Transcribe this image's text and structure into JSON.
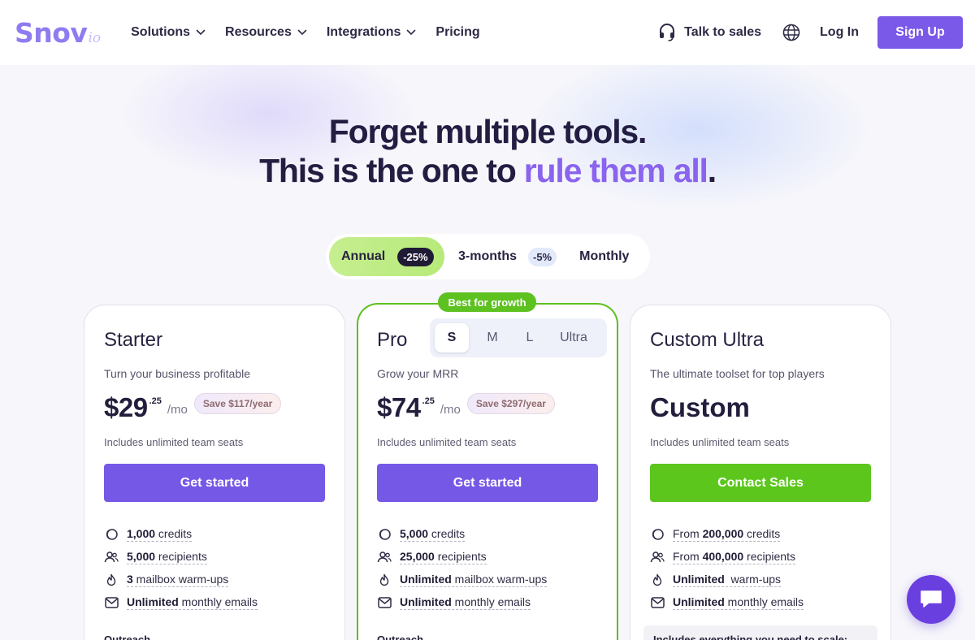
{
  "brand": {
    "logo_main": "Snov",
    "logo_sub": "io"
  },
  "nav": {
    "links": [
      {
        "label": "Solutions",
        "has_dropdown": true
      },
      {
        "label": "Resources",
        "has_dropdown": true
      },
      {
        "label": "Integrations",
        "has_dropdown": true
      },
      {
        "label": "Pricing",
        "has_dropdown": false
      }
    ],
    "talk_to_sales": "Talk to sales",
    "login": "Log In",
    "signup": "Sign Up"
  },
  "headline": {
    "line1": "Forget multiple tools.",
    "line2_prefix": "This is the one to ",
    "line2_accent": "rule them all",
    "line2_suffix": "."
  },
  "billing": {
    "options": [
      {
        "label": "Annual",
        "badge": "-25%",
        "selected": true
      },
      {
        "label": "3-months",
        "badge": "-5%",
        "selected": false
      },
      {
        "label": "Monthly",
        "badge": "",
        "selected": false
      }
    ]
  },
  "plans": {
    "starter": {
      "name": "Starter",
      "desc": "Turn your business profitable",
      "price": "$29",
      "cents": ".25",
      "per": "/mo",
      "save": "Save $117/year",
      "seats": "Includes unlimited team seats",
      "cta": "Get started",
      "features": [
        {
          "bold": "1,000",
          "text": " credits",
          "icon": "credits-icon"
        },
        {
          "bold": "5,000",
          "text": " recipients",
          "icon": "users-icon"
        },
        {
          "bold": "3",
          "text": " mailbox warm-ups",
          "icon": "flame-icon"
        },
        {
          "bold": "Unlimited",
          "text": " monthly emails",
          "icon": "mail-icon"
        }
      ],
      "section": "Outreach"
    },
    "pro": {
      "badge": "Best for growth",
      "name": "Pro",
      "sizes": [
        "S",
        "M",
        "L",
        "Ultra"
      ],
      "selected_size": "S",
      "desc": "Grow your MRR",
      "price": "$74",
      "cents": ".25",
      "per": "/mo",
      "save": "Save $297/year",
      "seats": "Includes unlimited team seats",
      "cta": "Get started",
      "features": [
        {
          "bold": "5,000",
          "text": " credits",
          "icon": "credits-icon"
        },
        {
          "bold": "25,000",
          "text": " recipients",
          "icon": "users-icon"
        },
        {
          "bold": "Unlimited",
          "text": " mailbox warm-ups",
          "icon": "flame-icon"
        },
        {
          "bold": "Unlimited",
          "text": " monthly emails",
          "icon": "mail-icon"
        }
      ],
      "section": "Outreach"
    },
    "custom": {
      "name": "Custom Ultra",
      "desc": "The ultimate toolset for top players",
      "price": "Custom",
      "seats": "Includes unlimited team seats",
      "cta": "Contact Sales",
      "features": [
        {
          "prefix": "From ",
          "bold": "200,000",
          "text": " credits",
          "icon": "credits-icon"
        },
        {
          "prefix": "From ",
          "bold": "400,000",
          "text": " recipients",
          "icon": "users-icon"
        },
        {
          "prefix": "",
          "bold": "Unlimited",
          "text": "  warm-ups",
          "icon": "flame-icon"
        },
        {
          "prefix": "",
          "bold": "Unlimited",
          "text": " monthly emails",
          "icon": "mail-icon"
        }
      ],
      "scale_note": "Includes everything you need to scale:"
    }
  },
  "colors": {
    "accent_purple": "#7658e6",
    "accent_green": "#5cc61d",
    "headline_accent": "#8a63ee"
  }
}
